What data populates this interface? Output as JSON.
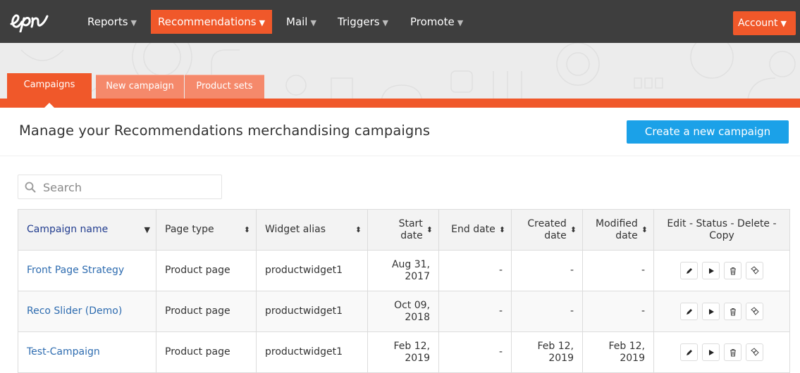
{
  "nav": {
    "items": [
      {
        "label": "Reports"
      },
      {
        "label": "Recommendations"
      },
      {
        "label": "Mail"
      },
      {
        "label": "Triggers"
      },
      {
        "label": "Promote"
      }
    ],
    "account_label": "Account",
    "active_color": "#f0582a",
    "bg_color": "#3e3e3e"
  },
  "tabs": [
    {
      "label": "Campaigns"
    },
    {
      "label": "New campaign"
    },
    {
      "label": "Product sets"
    }
  ],
  "page": {
    "title": "Manage your Recommendations merchandising campaigns",
    "create_button": "Create a new campaign",
    "search_placeholder": "Search"
  },
  "table": {
    "headers": {
      "name": "Campaign name",
      "page_type": "Page type",
      "widget_alias": "Widget alias",
      "start_date": "Start date",
      "end_date": "End date",
      "created_date": "Created date",
      "modified_date": "Modified date",
      "actions": "Edit - Status - Delete - Copy"
    },
    "rows": [
      {
        "name": "Front Page Strategy",
        "page_type": "Product page",
        "widget_alias": "productwidget1",
        "start_date": "Aug 31, 2017",
        "end_date": "-",
        "created_date": "-",
        "modified_date": "-"
      },
      {
        "name": "Reco Slider (Demo)",
        "page_type": "Product page",
        "widget_alias": "productwidget1",
        "start_date": "Oct 09, 2018",
        "end_date": "-",
        "created_date": "-",
        "modified_date": "-"
      },
      {
        "name": "Test-Campaign",
        "page_type": "Product page",
        "widget_alias": "productwidget1",
        "start_date": "Feb 12, 2019",
        "end_date": "-",
        "created_date": "Feb 12, 2019",
        "modified_date": "Feb 12, 2019"
      }
    ]
  },
  "icons": [
    "epi-logo-icon",
    "search-icon",
    "edit-icon",
    "play-icon",
    "trash-icon",
    "copy-icon",
    "sort-icon",
    "caret-down-icon"
  ]
}
